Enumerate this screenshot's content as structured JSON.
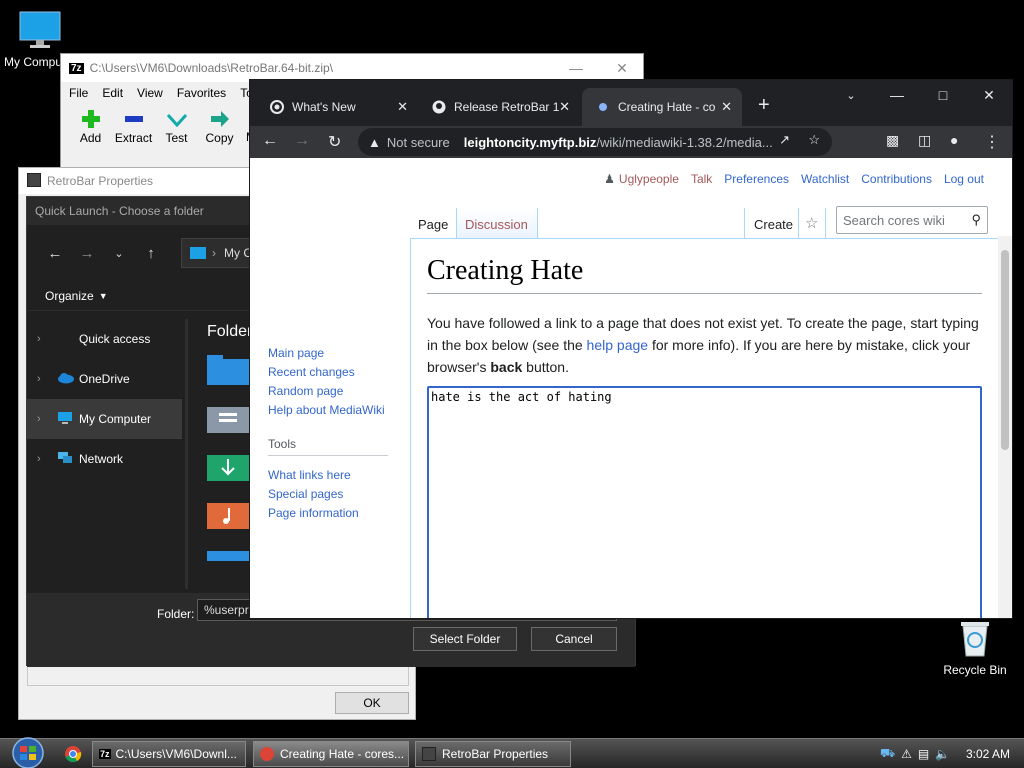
{
  "desktop": {
    "icons": [
      {
        "label": "My Computer"
      },
      {
        "label": "Recycle Bin"
      }
    ]
  },
  "zip_window": {
    "title": "C:\\Users\\VM6\\Downloads\\RetroBar.64-bit.zip\\",
    "menu": [
      "File",
      "Edit",
      "View",
      "Favorites",
      "Too"
    ],
    "tools": [
      "Add",
      "Extract",
      "Test",
      "Copy",
      "M"
    ]
  },
  "retrobar_window": {
    "title": "RetroBar Properties",
    "ok_label": "OK"
  },
  "folder_picker": {
    "title": "Quick Launch - Choose a folder",
    "address": "My Con",
    "organize_label": "Organize",
    "tree": [
      "Quick access",
      "OneDrive",
      "My Computer",
      "Network"
    ],
    "folders_header": "Folder",
    "folder_label": "Folder:",
    "folder_value": "%userpro",
    "select_label": "Select Folder",
    "cancel_label": "Cancel"
  },
  "chrome": {
    "tabs": [
      {
        "label": "What's New"
      },
      {
        "label": "Release RetroBar 1"
      },
      {
        "label": "Creating Hate - co"
      }
    ],
    "url_security": "Not secure",
    "url_host": "leightoncity.myftp.biz",
    "url_path": "/wiki/mediawiki-1.38.2/media..."
  },
  "wiki": {
    "user_links": [
      "Uglypeople",
      "Talk",
      "Preferences",
      "Watchlist",
      "Contributions",
      "Log out"
    ],
    "tabs": {
      "page": "Page",
      "discussion": "Discussion",
      "create": "Create"
    },
    "search_placeholder": "Search cores wiki",
    "sidebar_nav": [
      "Main page",
      "Recent changes",
      "Random page",
      "Help about MediaWiki"
    ],
    "tools_heading": "Tools",
    "tools": [
      "What links here",
      "Special pages",
      "Page information"
    ],
    "heading": "Creating Hate",
    "intro_1": "You have followed a link to a page that does not exist yet. To create the page, start typing in the box below (see the ",
    "intro_link": "help page",
    "intro_2": " for more info). If you are here by mistake, click your browser's ",
    "intro_bold": "back",
    "intro_3": " button.",
    "editor_text": "hate is the act of hating"
  },
  "taskbar": {
    "buttons": [
      {
        "label": "C:\\Users\\VM6\\Downl..."
      },
      {
        "label": "Creating Hate - cores..."
      },
      {
        "label": "RetroBar Properties"
      }
    ],
    "clock": "3:02 AM"
  }
}
